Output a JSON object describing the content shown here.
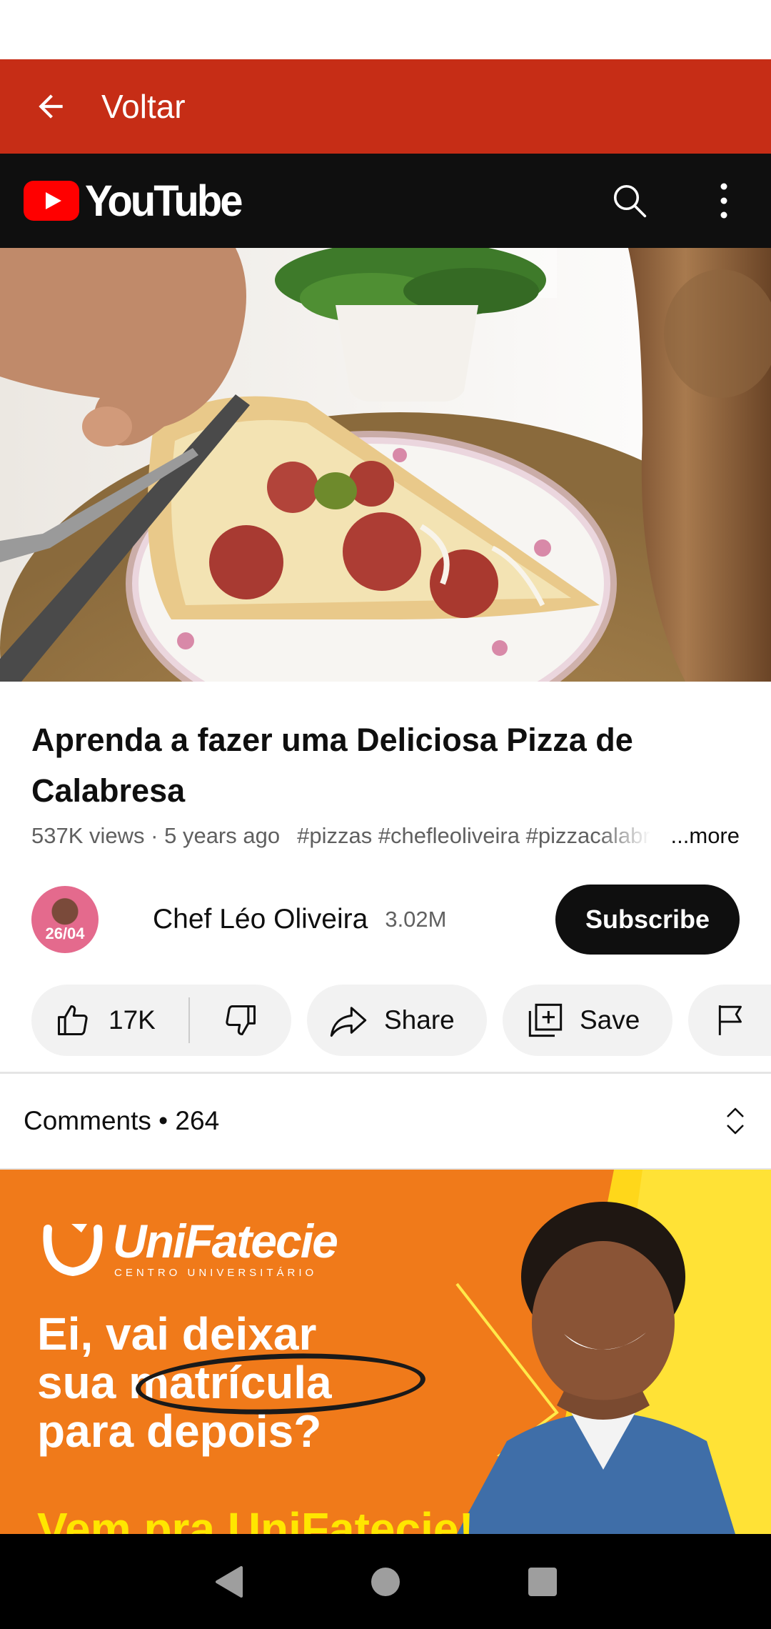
{
  "app_bar": {
    "title": "Voltar",
    "back_icon": "arrow-back-icon"
  },
  "yt_header": {
    "brand": "YouTube",
    "search_icon": "search-icon",
    "menu_icon": "more-vert-icon"
  },
  "video": {
    "title": "Aprenda a fazer uma Deliciosa Pizza de Calabresa",
    "views": "537K views",
    "age": "5 years ago",
    "hashtags": "#pizzas #chefleoliveira #pizzacalabresa",
    "more_label": "...more"
  },
  "channel": {
    "name": "Chef Léo Oliveira",
    "subscribers": "3.02M",
    "avatar_label": "26/04",
    "subscribe_label": "Subscribe"
  },
  "actions": {
    "like_count": "17K",
    "share_label": "Share",
    "save_label": "Save",
    "report_label": "Report"
  },
  "comments": {
    "label": "Comments",
    "separator": "•",
    "count": "264"
  },
  "ad": {
    "brand": "UniFatecie",
    "brand_sub": "CENTRO UNIVERSITÁRIO",
    "headline_1": "Ei, vai deixar",
    "headline_2": "sua matrícula",
    "headline_3": "para depois?",
    "cta": "Vem pra UniFatecie!",
    "colors": {
      "background": "#f07a1a",
      "accent": "#ffe600"
    }
  },
  "colors": {
    "app_bar": "#c62d16",
    "yt_header": "#0f0f0f",
    "yt_red": "#ff0000"
  }
}
